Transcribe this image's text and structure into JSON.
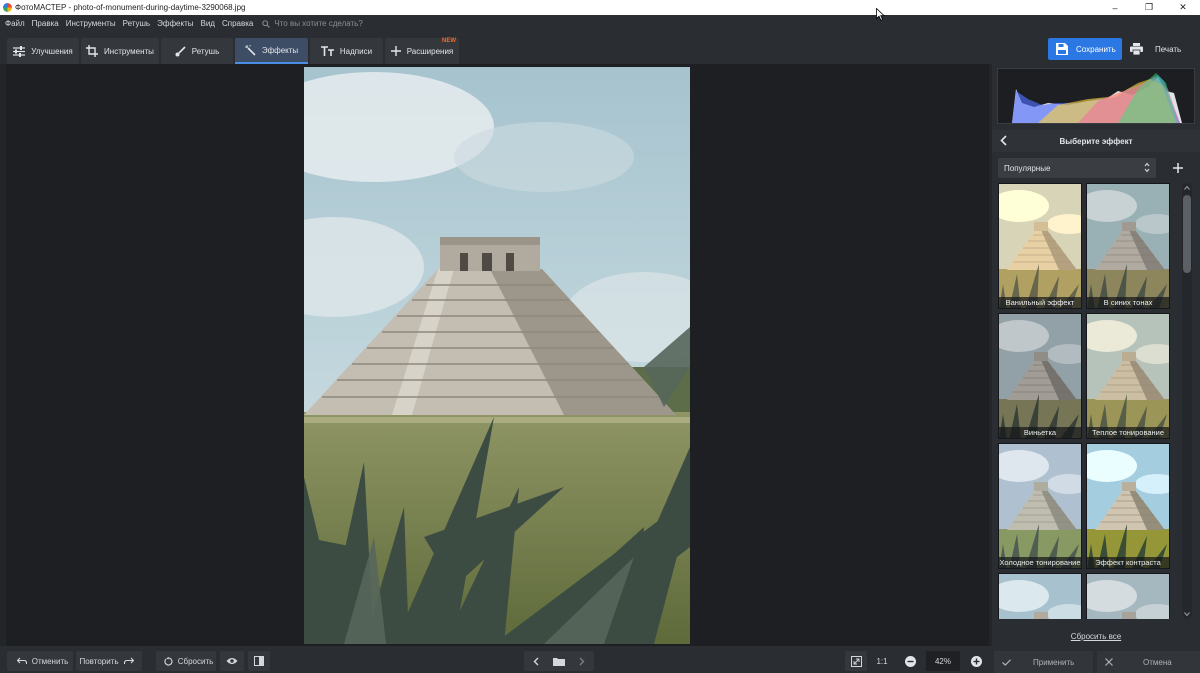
{
  "window": {
    "title": "ФотоМАСТЕР - photo-of-monument-during-daytime-3290068.jpg",
    "controls": [
      "–",
      "❐",
      "✕"
    ]
  },
  "menu": {
    "items": [
      "Файл",
      "Правка",
      "Инструменты",
      "Ретушь",
      "Эффекты",
      "Вид",
      "Справка"
    ],
    "search_placeholder": "Что вы хотите сделать?"
  },
  "toolbar": {
    "tabs": [
      {
        "label": "Улучшения",
        "icon": "sliders-icon",
        "active": false
      },
      {
        "label": "Инструменты",
        "icon": "crop-icon",
        "active": false
      },
      {
        "label": "Ретушь",
        "icon": "brush-icon",
        "active": false
      },
      {
        "label": "Эффекты",
        "icon": "magic-wand-icon",
        "active": true
      },
      {
        "label": "Надписи",
        "icon": "text-icon",
        "active": false
      },
      {
        "label": "Расширения",
        "icon": "plus-icon",
        "active": false,
        "badge": "NEW"
      }
    ],
    "save_label": "Сохранить",
    "print_label": "Печать"
  },
  "panel": {
    "header_title": "Выберите эффект",
    "category": "Популярные",
    "effects": [
      {
        "label": "Ванильный эффект"
      },
      {
        "label": "В синих тонах"
      },
      {
        "label": "Виньетка"
      },
      {
        "label": "Теплое тонирование"
      },
      {
        "label": "Холодное тонирование"
      },
      {
        "label": "Эффект контраста"
      },
      {
        "label": ""
      },
      {
        "label": ""
      }
    ],
    "reset_all_label": "Сбросить все"
  },
  "bottom": {
    "undo_label": "Отменить",
    "redo_label": "Повторить",
    "reset_label": "Сбросить",
    "one_to_one_label": "1:1",
    "zoom": "42%",
    "apply_label": "Применить",
    "cancel_label": "Отмена"
  },
  "colors": {
    "accent": "#2b78e4",
    "active_tab": "#3d4d66",
    "new_badge": "#f06a2a"
  }
}
